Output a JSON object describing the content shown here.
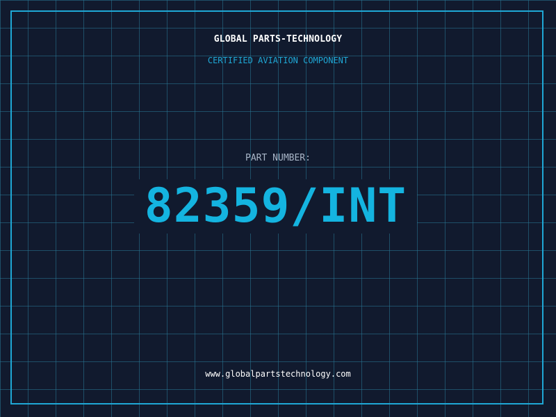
{
  "brand": {
    "name": "GLOBAL PARTS-TECHNOLOGY",
    "subtitle": "CERTIFIED AVIATION COMPONENT"
  },
  "part": {
    "label": "PART NUMBER:",
    "number": "82359/INT"
  },
  "footer": {
    "website": "www.globalpartstechnology.com"
  },
  "colors": {
    "background": "#111a2e",
    "grid": "#287896",
    "accent": "#14b4e0",
    "frame": "#1fa8d6",
    "text_primary": "#ffffff",
    "text_muted": "#a9b6c8"
  }
}
